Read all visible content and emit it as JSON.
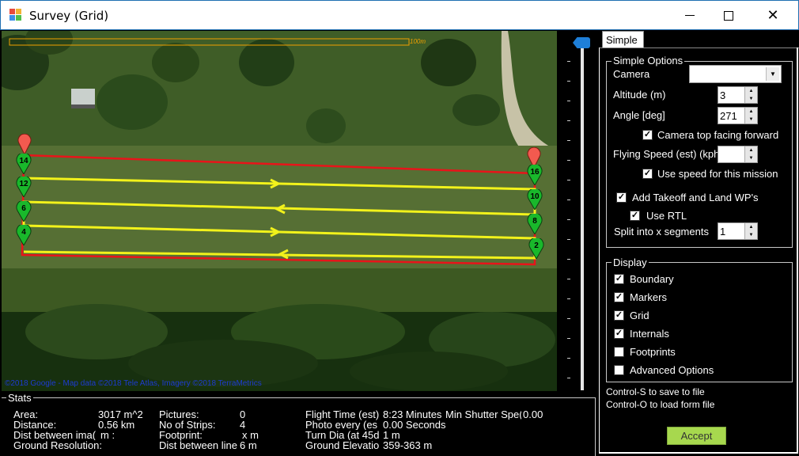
{
  "window": {
    "title": "Survey (Grid)",
    "minimize_icon": "minimize-icon",
    "maximize_icon": "maximize-icon",
    "close_icon": "close-icon"
  },
  "map": {
    "scale_label": "100m",
    "copyright": "©2018 Google - Map data ©2018 Tele Atlas, Imagery ©2018 TerraMetrics",
    "markers": [
      "14",
      "12",
      "6",
      "4",
      "16",
      "10",
      "8",
      "2"
    ],
    "colors": {
      "boundary": "#e8141a",
      "grid": "#f2f21b",
      "marker_green": "#19b82b",
      "marker_red": "#f25a4f",
      "scale_bar": "#f0a000"
    }
  },
  "zoom": {
    "thumb_icon": "zoom-thumb-icon"
  },
  "tabs": [
    {
      "label": "Simple"
    }
  ],
  "simple_options": {
    "title": "Simple Options",
    "camera_label": "Camera",
    "camera_value": "",
    "altitude_label": "Altitude (m)",
    "altitude_value": "3",
    "angle_label": "Angle [deg]",
    "angle_value": "271",
    "camera_top_label": "Camera top facing forward",
    "flying_speed_label": "Flying Speed (est) (kph)",
    "flying_speed_value": "",
    "use_speed_label": "Use speed for this mission",
    "takeoff_land_label": "Add Takeoff and Land WP's",
    "use_rtl_label": "Use RTL",
    "split_label": "Split into x segments",
    "split_value": "1"
  },
  "display": {
    "title": "Display",
    "items": [
      {
        "label": "Boundary",
        "checked": true
      },
      {
        "label": "Markers",
        "checked": true
      },
      {
        "label": "Grid",
        "checked": true
      },
      {
        "label": "Internals",
        "checked": true
      },
      {
        "label": "Footprints",
        "checked": false
      },
      {
        "label": "Advanced Options",
        "checked": false
      }
    ]
  },
  "hints": {
    "save": "Control-S to save to file",
    "load": "Control-O to load form file"
  },
  "accept_label": "Accept",
  "stats": {
    "title": "Stats",
    "area_label": "Area:",
    "area_value": "3017 m^2",
    "distance_label": "Distance:",
    "distance_value": "0.56 km",
    "dist_images_label": "Dist between ima(",
    "dist_images_value": "m :",
    "ground_res_label": "Ground Resolution:",
    "pictures_label": "Pictures:",
    "pictures_value": "0",
    "strips_label": "No of Strips:",
    "strips_value": "4",
    "footprint_label": "Footprint:",
    "footprint_value": "x  m",
    "dist_lines_label": "Dist between line",
    "dist_lines_value": "6 m",
    "flight_time_label": "Flight Time (est)",
    "flight_time_value": "8:23 Minutes",
    "min_shutter_label": "Min Shutter Spe(",
    "min_shutter_value": "0.00",
    "photo_every_label": "Photo every (es",
    "photo_every_value": "0.00 Seconds",
    "turn_dia_label": "Turn Dia (at 45d",
    "turn_dia_value": "1 m",
    "ground_elev_label": "Ground Elevatio",
    "ground_elev_value": "359-363 m"
  }
}
